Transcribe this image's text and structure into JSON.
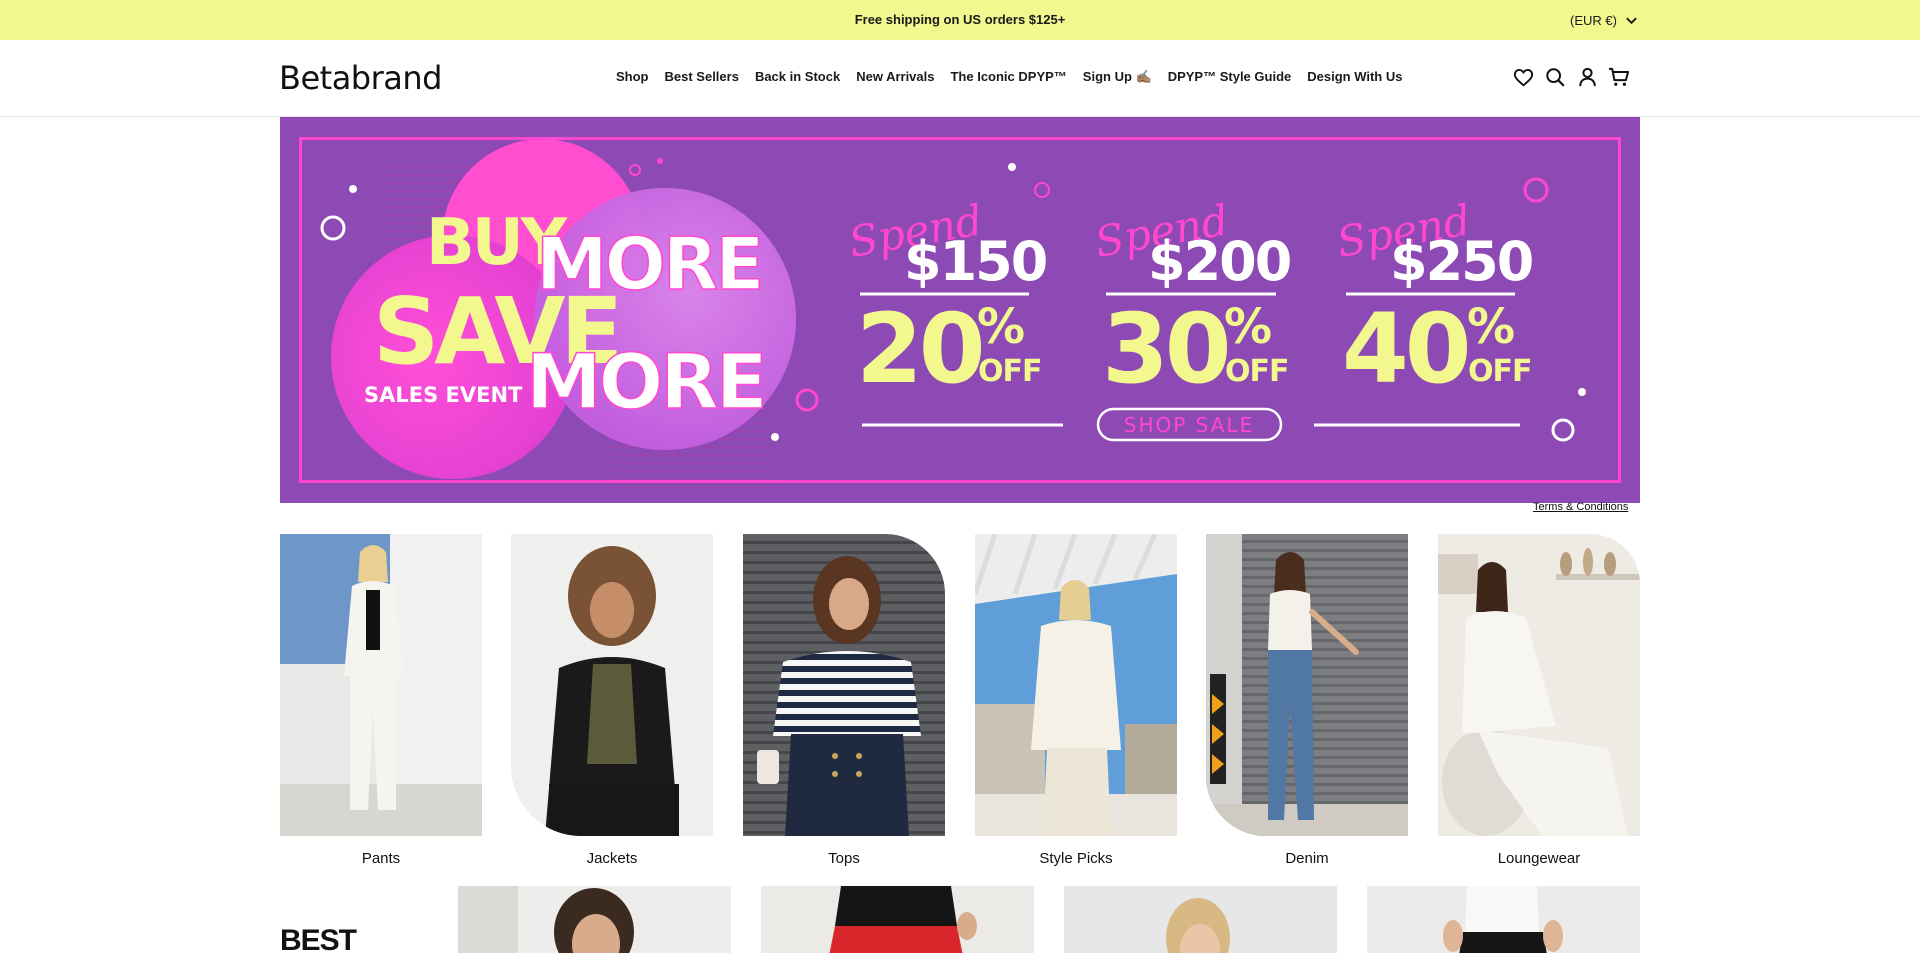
{
  "announcement": {
    "message": "Free shipping on US orders $125+",
    "currency": "(EUR €)"
  },
  "header": {
    "logo": "Betabrand",
    "nav": [
      {
        "label": "Shop"
      },
      {
        "label": "Best Sellers"
      },
      {
        "label": "Back in Stock"
      },
      {
        "label": "New Arrivals"
      },
      {
        "label": "The Iconic DPYP™"
      },
      {
        "label": "Sign Up ✍🏽"
      },
      {
        "label": "DPYP™ Style Guide"
      },
      {
        "label": "Design With Us"
      }
    ],
    "icons": [
      "heart-icon",
      "search-icon",
      "account-icon",
      "cart-icon"
    ]
  },
  "hero": {
    "headline_buy": "BUY",
    "headline_more1": "MORE",
    "headline_save": "SAVE",
    "headline_more2": "MORE",
    "subtitle": "SALES EVENT",
    "tiers": [
      {
        "spend_label": "Spend",
        "amount": "$150",
        "percent": "20",
        "off": "OFF"
      },
      {
        "spend_label": "Spend",
        "amount": "$200",
        "percent": "30",
        "off": "OFF"
      },
      {
        "spend_label": "Spend",
        "amount": "$250",
        "percent": "40",
        "off": "OFF"
      }
    ],
    "cta": "SHOP SALE",
    "colors": {
      "background": "#8d4ab4",
      "accent_pink": "#ff48cf",
      "accent_yellow": "#f2f78e"
    }
  },
  "terms_link": "Terms & Conditions",
  "categories": [
    {
      "label": "Pants"
    },
    {
      "label": "Jackets"
    },
    {
      "label": "Tops"
    },
    {
      "label": "Style Picks"
    },
    {
      "label": "Denim"
    },
    {
      "label": "Loungewear"
    }
  ],
  "best_sellers": {
    "title": "BEST"
  }
}
